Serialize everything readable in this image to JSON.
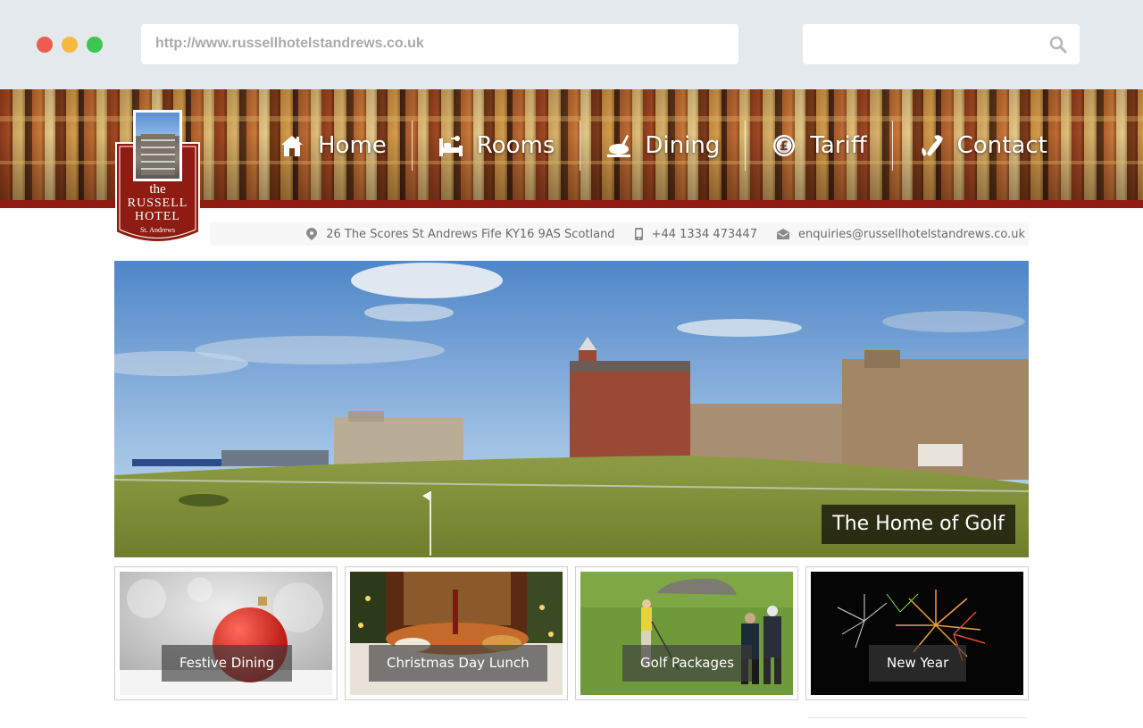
{
  "browser": {
    "url": "http://www.russellhotelstandrews.co.uk",
    "search_placeholder": ""
  },
  "logo": {
    "line1": "the",
    "line2": "RUSSELL",
    "line3": "HOTEL",
    "line4": "St. Andrews"
  },
  "nav": {
    "items": [
      {
        "label": "Home",
        "icon": "home-icon"
      },
      {
        "label": "Rooms",
        "icon": "bed-icon"
      },
      {
        "label": "Dining",
        "icon": "dining-icon"
      },
      {
        "label": "Tariff",
        "icon": "pound-icon"
      },
      {
        "label": "Contact",
        "icon": "phone-icon"
      }
    ]
  },
  "contact": {
    "address": "26 The Scores St Andrews Fife KY16 9AS Scotland",
    "phone": "+44 1334 473447",
    "email": "enquiries@russellhotelstandrews.co.uk"
  },
  "hero": {
    "caption": "The Home of Golf"
  },
  "tiles": [
    {
      "label": "Festive Dining"
    },
    {
      "label": "Christmas Day Lunch"
    },
    {
      "label": "Golf Packages"
    },
    {
      "label": "New Year"
    }
  ],
  "colors": {
    "brand_red": "#8e1c12",
    "chrome_bg": "#e4e9ed"
  }
}
